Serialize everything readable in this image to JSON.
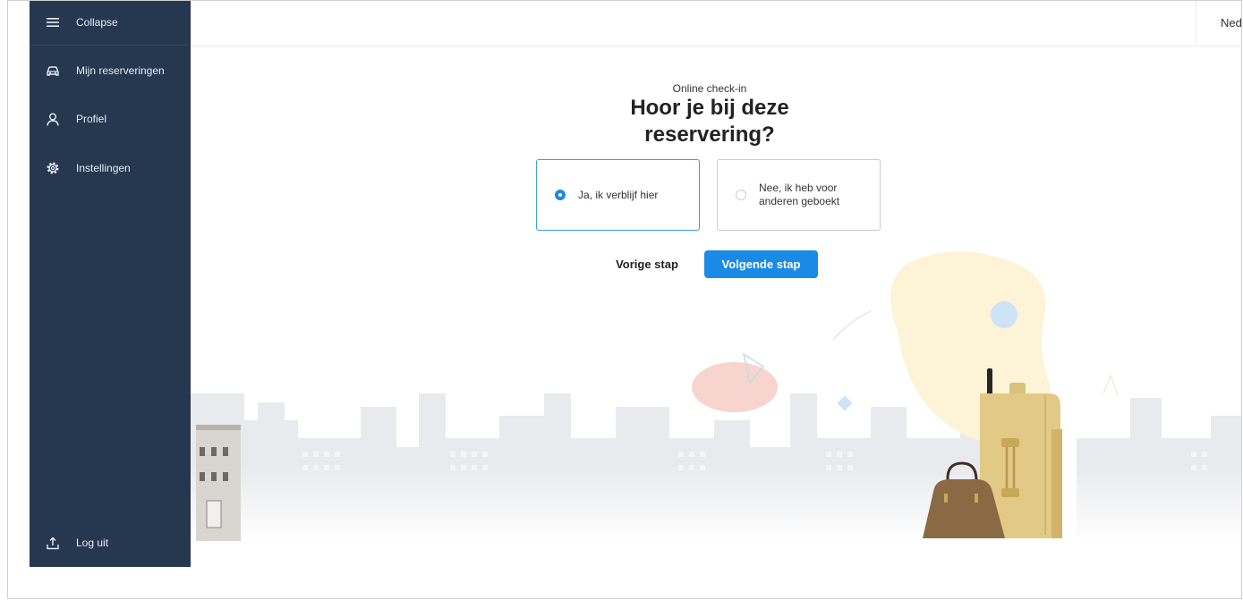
{
  "sidebar": {
    "collapse_label": "Collapse",
    "items": [
      {
        "label": "Mijn reserveringen",
        "icon": "car-icon"
      },
      {
        "label": "Profiel",
        "icon": "user-icon"
      },
      {
        "label": "Instellingen",
        "icon": "gear-icon"
      }
    ],
    "logout_label": "Log uit"
  },
  "header": {
    "language": "Nederlands"
  },
  "main": {
    "subtitle": "Online check-in",
    "title_line1": "Hoor je bij deze",
    "title_line2": "reservering?",
    "options": [
      {
        "label": "Ja, ik verblijf hier",
        "selected": true
      },
      {
        "label": "Nee, ik heb voor anderen geboekt",
        "selected": false
      }
    ],
    "prev_label": "Vorige stap",
    "next_label": "Volgende stap"
  },
  "colors": {
    "sidebar_bg": "#263750",
    "accent": "#1a8ae6"
  }
}
